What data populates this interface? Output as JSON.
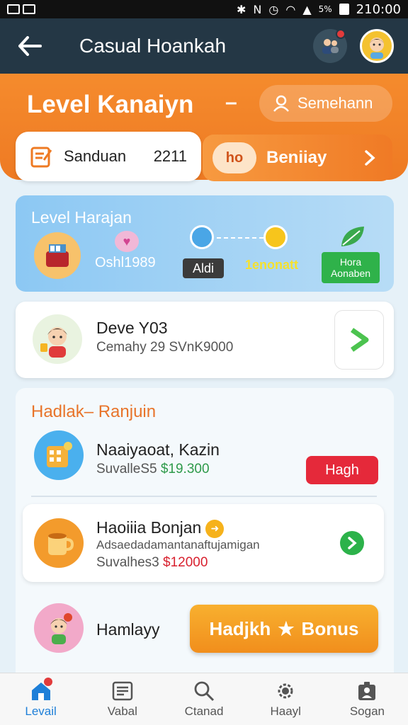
{
  "status_bar": {
    "time": "210:00",
    "battery_text": "5%"
  },
  "app_bar": {
    "title": "Casual Hoankah"
  },
  "header": {
    "level_title": "Level Kanaiyn",
    "dash": "–",
    "user_chip_label": "Semehann"
  },
  "quick_cards": {
    "left": {
      "label": "Sanduan",
      "count": "2211"
    },
    "right": {
      "badge": "ho",
      "label": "Beniiay"
    }
  },
  "progress": {
    "title": "Level Harajan",
    "stat": "Oshl1989",
    "pill": "Aldi",
    "yellow_text": "1enonatt",
    "green_tag_line1": "Hora",
    "green_tag_line2": "Aonaben"
  },
  "profile": {
    "name": "Deve Y03",
    "subtitle": "Cemahy 29 SVnK9000"
  },
  "ranking": {
    "title": "Hadlak– Ranjuin",
    "items": [
      {
        "name": "Naaiyaoat, Kazin",
        "sub_prefix": "SuvalleS5",
        "value": "$19.300",
        "action": "Hagh"
      },
      {
        "name": "Haoiiia Bonjan",
        "desc": "Adsaedadamantanaftujamigan",
        "sub_prefix": "Suvalhes3",
        "value": "$12000"
      },
      {
        "name": "Hamlayy",
        "bonus_label_left": "Hadjkh",
        "bonus_label_right": "Bonus"
      }
    ]
  },
  "bottom_nav": [
    {
      "label": "Levail",
      "icon": "home-icon",
      "active": true
    },
    {
      "label": "Vabal",
      "icon": "news-icon",
      "active": false
    },
    {
      "label": "Ctanad",
      "icon": "search-icon",
      "active": false
    },
    {
      "label": "Haayl",
      "icon": "gear-icon",
      "active": false
    },
    {
      "label": "Sogan",
      "icon": "profile-icon",
      "active": false
    }
  ],
  "colors": {
    "app_bar": "#243745",
    "header_orange": "#f58b2d",
    "accent_blue": "#1e7fd8",
    "action_red": "#e5293a",
    "green": "#2cb24a"
  }
}
